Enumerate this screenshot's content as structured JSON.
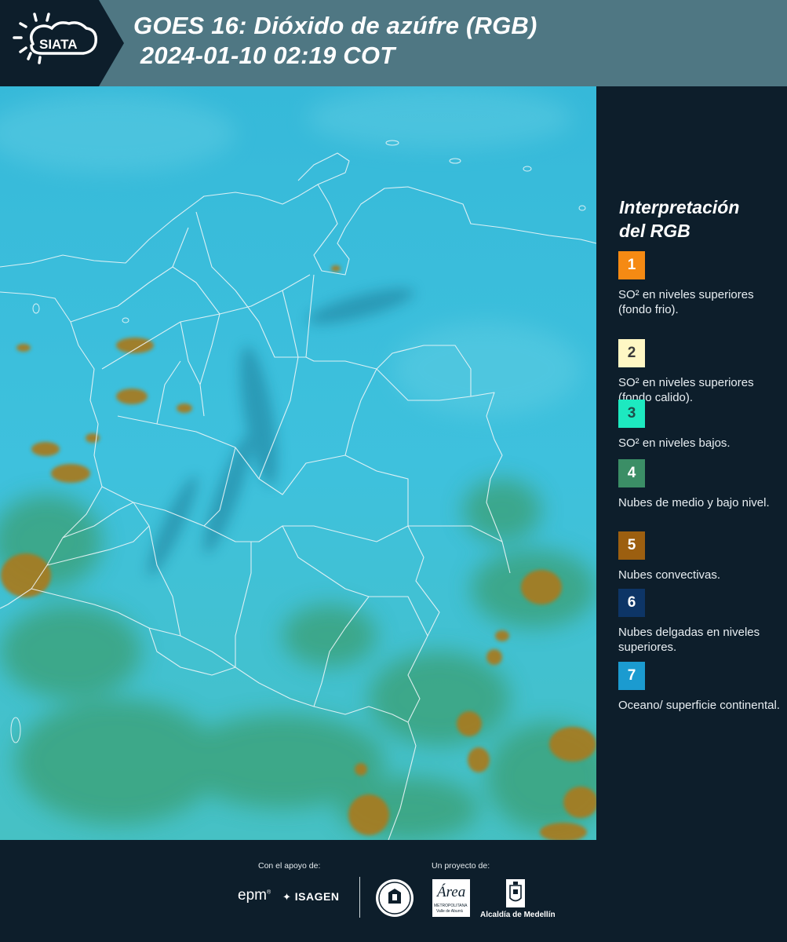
{
  "header": {
    "logo_text": "SIATA",
    "title_line1": "GOES 16: Dióxido de azúfre (RGB)",
    "title_line2": " 2024-01-10 02:19 COT"
  },
  "legend": {
    "title_line1": "Interpretación",
    "title_line2": "del RGB",
    "items": [
      {
        "number": "1",
        "label": "SO² en niveles superiores (fondo frio).",
        "color": "#f58a13",
        "text_color": "#ffffff"
      },
      {
        "number": "2",
        "label": "SO² en niveles superiores (fondo calido).",
        "color": "#fff7c4",
        "text_color": "#3a3a3a"
      },
      {
        "number": "3",
        "label": "SO² en niveles bajos.",
        "color": "#1de9c0",
        "text_color": "#1e4e4a"
      },
      {
        "number": "4",
        "label": "Nubes de medio y bajo nivel.",
        "color": "#3b8e66",
        "text_color": "#ffffff"
      },
      {
        "number": "5",
        "label": "Nubes convectivas.",
        "color": "#9c5f10",
        "text_color": "#ffffff"
      },
      {
        "number": "6",
        "label": "Nubes delgadas en niveles superiores.",
        "color": "#0d3566",
        "text_color": "#ffffff"
      },
      {
        "number": "7",
        "label": "Oceano/ superficie continental.",
        "color": "#1b9bd0",
        "text_color": "#ffffff"
      }
    ]
  },
  "footer": {
    "support_label": "Con el apoyo de:",
    "project_label": "Un proyecto de:",
    "epm": "epm",
    "isagen": "ISAGEN",
    "area_name": "Área",
    "area_sub1": "METROPOLITANA",
    "area_sub2": "Valle de Aburrá",
    "alcaldia": "Alcaldía de Medellín"
  },
  "colors": {
    "header_bg": "#4f7783",
    "panel_bg": "#0d1e2b",
    "map_base": "#3cbcd8"
  }
}
